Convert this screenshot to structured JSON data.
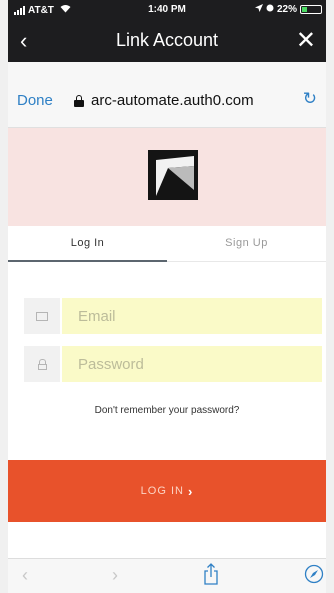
{
  "status_bar": {
    "carrier": "AT&T",
    "time": "1:40 PM",
    "battery": "22%"
  },
  "nav": {
    "back_icon": "‹",
    "title": "Link Account",
    "close_icon": "✕"
  },
  "browser": {
    "done_label": "Done",
    "url": "arc-automate.auth0.com",
    "reload_icon": "↻"
  },
  "tabs": [
    {
      "label": "Log In",
      "active": true
    },
    {
      "label": "Sign Up",
      "active": false
    }
  ],
  "form": {
    "email_placeholder": "Email",
    "password_placeholder": "Password",
    "forgot_label": "Don't remember your password?"
  },
  "login_button": {
    "label": "LOG IN",
    "chevron": "›"
  },
  "toolbar": {
    "back_icon": "‹",
    "forward_icon": "›"
  },
  "colors": {
    "accent": "#e8522b",
    "link": "#2f80c5",
    "header_bg": "#f8e3e1",
    "input_bg": "#fafac8"
  }
}
